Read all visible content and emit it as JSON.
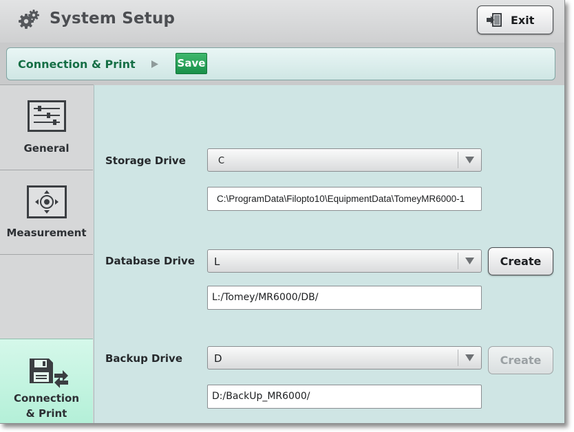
{
  "header": {
    "title": "System Setup",
    "exit_label": "Exit"
  },
  "breadcrumb": {
    "current": "Connection & Print",
    "save_label": "Save"
  },
  "sidebar": {
    "items": [
      {
        "label": "General",
        "icon": "sliders-icon",
        "selected": false
      },
      {
        "label": "Measurement",
        "icon": "crosshair-icon",
        "selected": false
      },
      {
        "label": "Connection\n& Print",
        "label_line1": "Connection",
        "label_line2": "& Print",
        "icon": "floppy-transfer-icon",
        "selected": true
      }
    ]
  },
  "form": {
    "storage": {
      "label": "Storage Drive",
      "drive": "C",
      "path": "C:\\ProgramData\\Filopto10\\EquipmentData\\TomeyMR6000-1"
    },
    "database": {
      "label": "Database Drive",
      "drive": "L",
      "path": "L:/Tomey/MR6000/DB/",
      "create_label": "Create",
      "create_enabled": true
    },
    "backup": {
      "label": "Backup Drive",
      "drive": "D",
      "path": "D:/BackUp_MR6000/",
      "create_label": "Create",
      "create_enabled": false
    }
  },
  "colors": {
    "accent_green": "#199049",
    "breadcrumb_text": "#166f46",
    "content_bg": "#cfe5e4",
    "selected_tab": "#b4f0d8"
  }
}
